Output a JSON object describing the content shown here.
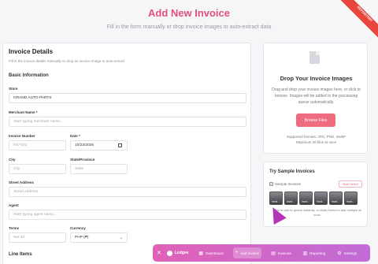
{
  "header": {
    "title": "Add New Invoice",
    "subtitle": "Fill in the form manually or drop invoice images to auto-extract data",
    "ribbon": "REPOSITORY"
  },
  "details": {
    "title": "Invoice Details",
    "subtitle": "Fill in the invoice details manually or drop an invoice image to auto-extract",
    "basic_title": "Basic Information",
    "store_label": "Store",
    "store_value": "GRAND AUTO PARTS",
    "merchant_label": "Merchant Name *",
    "merchant_placeholder": "Start typing merchant name...",
    "invoice_number_label": "Invoice Number",
    "invoice_number_placeholder": "INV-001",
    "date_label": "Date *",
    "date_value": "10/23/2025",
    "city_label": "City",
    "city_placeholder": "City",
    "state_label": "State/Province",
    "state_placeholder": "State",
    "street_label": "Street Address",
    "street_placeholder": "Street address",
    "agent_label": "Agent",
    "agent_placeholder": "Start typing agent name...",
    "terms_label": "Terms",
    "terms_placeholder": "Net 30",
    "currency_label": "Currency",
    "currency_value": "PHP (₱)",
    "line_items_title": "Line Items"
  },
  "dropzone": {
    "title": "Drop Your Invoice Images",
    "description": "Drag and drop your invoice images here, or click to browse. Images will be added to the processing queue automatically.",
    "browse_label": "Browse Files",
    "formats": "Supported formats: JPG, PNG, WebP",
    "max": "Maximum 20 files at once"
  },
  "samples": {
    "title": "Try Sample Invoices",
    "checkbox_label": "Sample Invoices",
    "multi_select": "Multi-Select",
    "thumb_label": "invoi...",
    "note": "Click to add to queue instantly, or Multi-Select to add multiple at once"
  },
  "nav": {
    "brand": "Ledgee",
    "items": [
      {
        "label": "Dashboard",
        "icon": "▦"
      },
      {
        "label": "Add Invoice",
        "icon": "+"
      },
      {
        "label": "Invoices",
        "icon": "▤"
      },
      {
        "label": "Reporting",
        "icon": "▥"
      },
      {
        "label": "Settings",
        "icon": "⚙"
      }
    ]
  }
}
